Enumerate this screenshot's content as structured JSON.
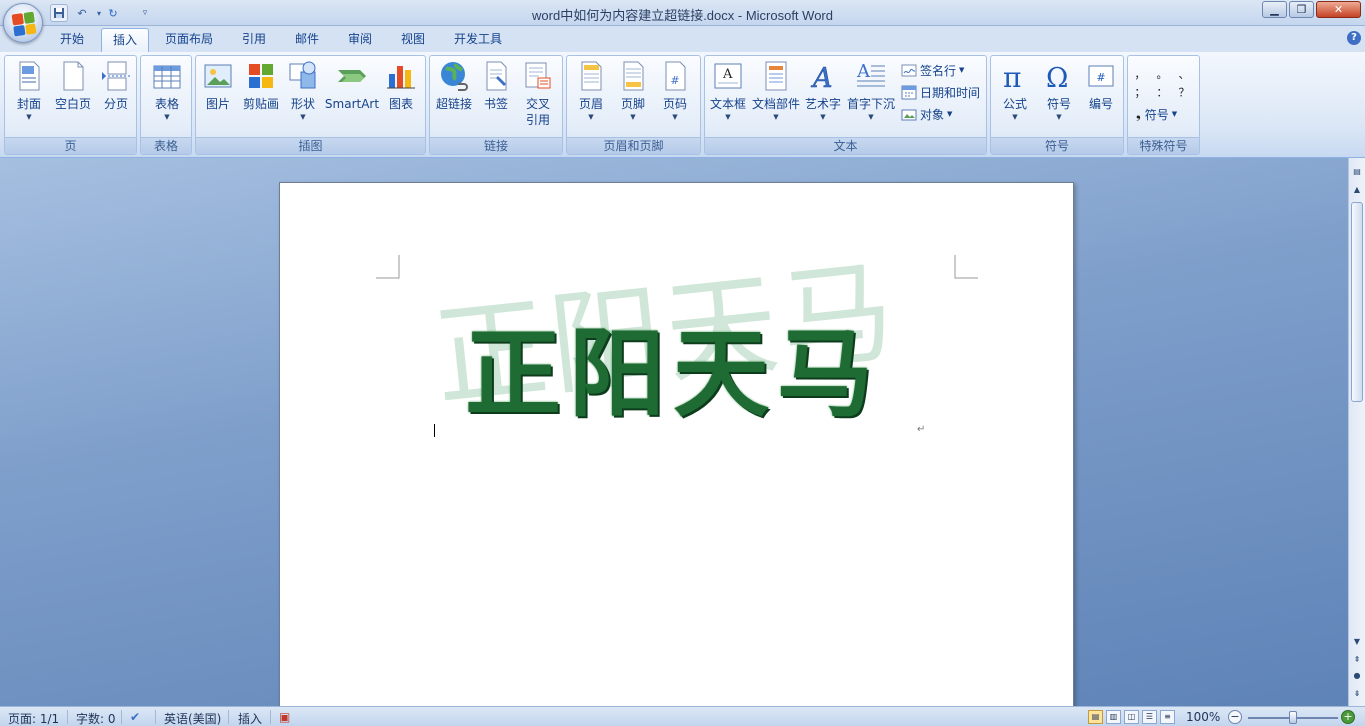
{
  "titlebar": {
    "title": "word中如何为内容建立超链接.docx - Microsoft Word"
  },
  "tabs": [
    {
      "label": "开始",
      "active": false
    },
    {
      "label": "插入",
      "active": true
    },
    {
      "label": "页面布局",
      "active": false
    },
    {
      "label": "引用",
      "active": false
    },
    {
      "label": "邮件",
      "active": false
    },
    {
      "label": "审阅",
      "active": false
    },
    {
      "label": "视图",
      "active": false
    },
    {
      "label": "开发工具",
      "active": false
    }
  ],
  "ribbon": {
    "groups": {
      "pages": {
        "caption": "页",
        "cover": "封面",
        "blank": "空白页",
        "break": "分页"
      },
      "tables": {
        "caption": "表格",
        "table": "表格"
      },
      "illustrations": {
        "caption": "插图",
        "picture": "图片",
        "clipart": "剪贴画",
        "shapes": "形状",
        "smartart": "SmartArt",
        "chart": "图表"
      },
      "links": {
        "caption": "链接",
        "hyperlink": "超链接",
        "bookmark": "书签",
        "crossref_line1": "交叉",
        "crossref_line2": "引用"
      },
      "header_footer": {
        "caption": "页眉和页脚",
        "header": "页眉",
        "footer": "页脚",
        "page_number": "页码"
      },
      "text": {
        "caption": "文本",
        "textbox": "文本框",
        "quickparts": "文档部件",
        "wordart": "艺术字",
        "dropcap": "首字下沉",
        "signature": "签名行",
        "datetime": "日期和时间",
        "object": "对象"
      },
      "symbols": {
        "caption": "符号",
        "equation": "公式",
        "symbol": "符号",
        "numbering": "编号"
      },
      "special": {
        "caption": "特殊符号",
        "symbols": [
          "，",
          "。",
          "、",
          "；",
          "：",
          "？"
        ],
        "more": "符号"
      }
    }
  },
  "document": {
    "watermark_text": "正阳天马",
    "wordart_text": "正阳天马",
    "paragraph_mark": "↵"
  },
  "statusbar": {
    "page": "页面: 1/1",
    "words": "字数: 0",
    "language": "英语(美国)",
    "mode": "插入",
    "zoom": "100%"
  },
  "colors": {
    "accent": "#15428b",
    "wordart": "#1f6b34",
    "watermark": "#cfe6d8",
    "ribbon_bg": "#dbe7f6",
    "workspace": "#7f9fcb"
  }
}
